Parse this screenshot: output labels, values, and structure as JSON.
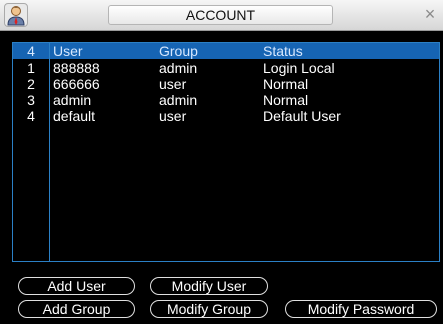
{
  "window": {
    "title": "ACCOUNT",
    "close_glyph": "×",
    "icon": "user-avatar-icon"
  },
  "table": {
    "headers": {
      "count": "4",
      "user": "User",
      "group": "Group",
      "status": "Status"
    },
    "rows": [
      {
        "num": "1",
        "user": "888888",
        "group": "admin",
        "status": "Login Local"
      },
      {
        "num": "2",
        "user": "666666",
        "group": "user",
        "status": "Normal"
      },
      {
        "num": "3",
        "user": "admin",
        "group": "admin",
        "status": "Normal"
      },
      {
        "num": "4",
        "user": "default",
        "group": "user",
        "status": "Default User"
      }
    ]
  },
  "buttons": {
    "add_user": "Add User",
    "modify_user": "Modify User",
    "add_group": "Add Group",
    "modify_group": "Modify Group",
    "modify_password": "Modify Password"
  },
  "colors": {
    "accent": "#1664b3",
    "border": "#2b80c6",
    "background": "#000000"
  }
}
